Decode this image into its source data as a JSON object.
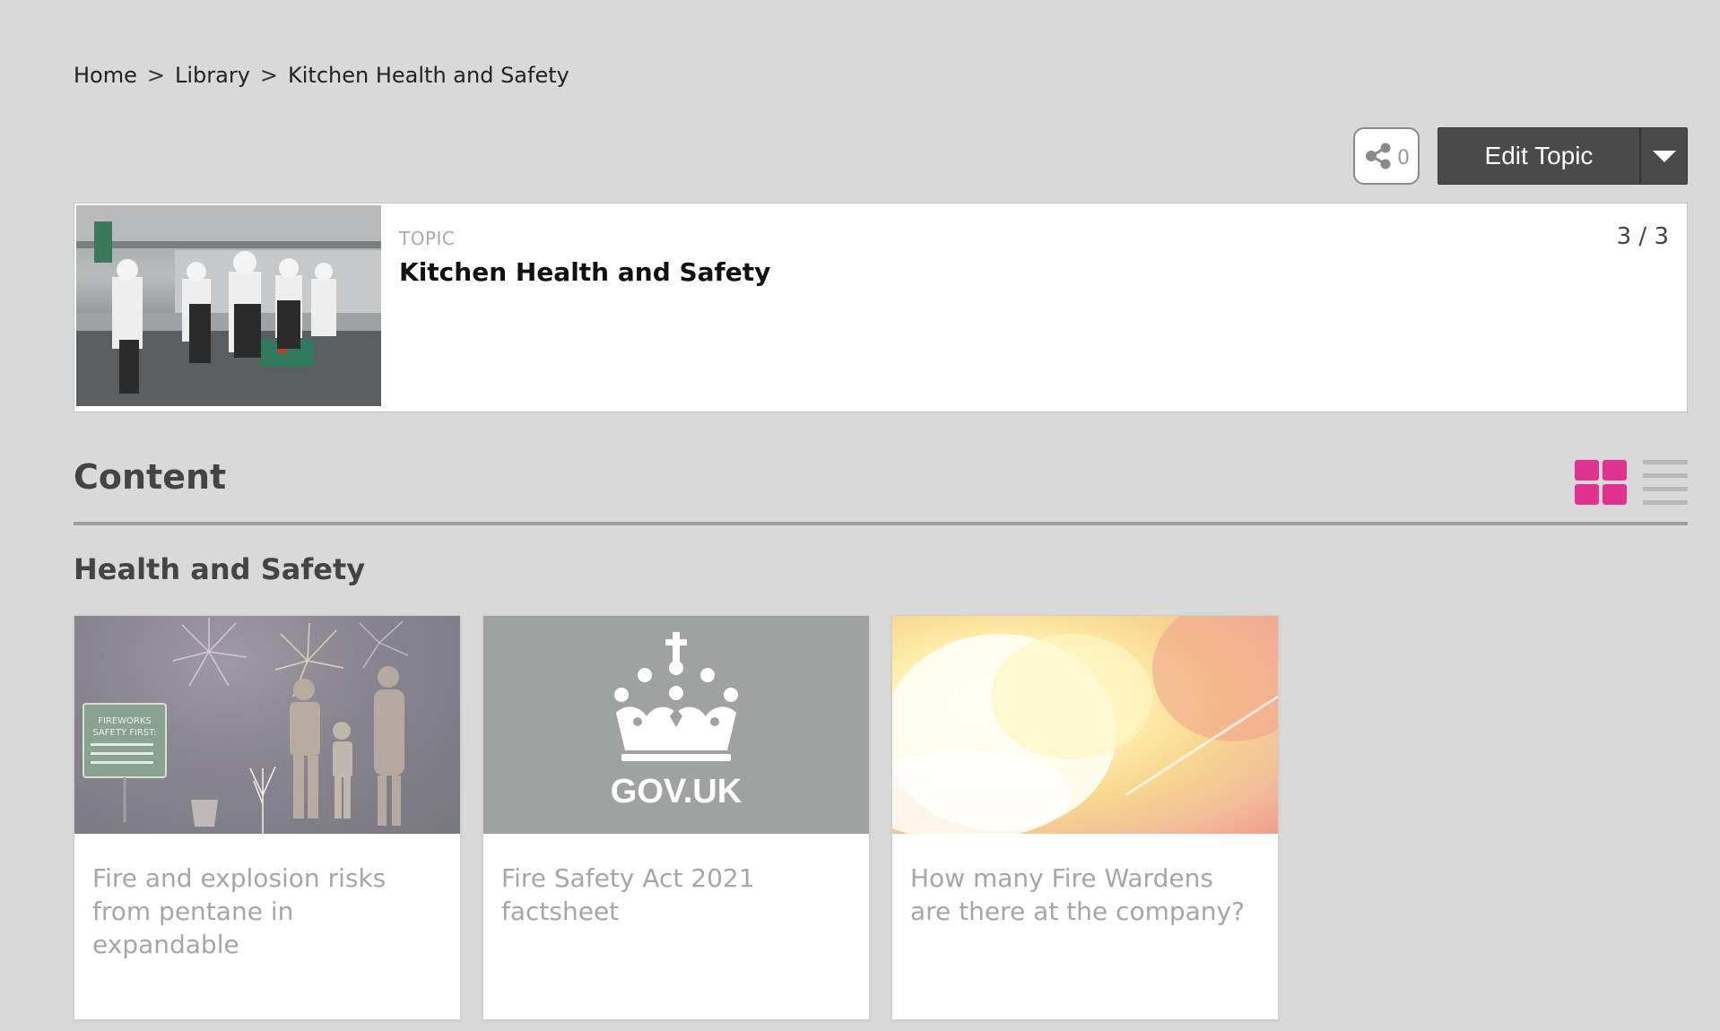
{
  "breadcrumb": {
    "items": [
      "Home",
      "Library"
    ],
    "current": "Kitchen Health and Safety",
    "separator": ">"
  },
  "actions": {
    "share_count": "0",
    "edit_label": "Edit Topic",
    "share_icon": "share-icon",
    "dropdown_icon": "caret-down-icon"
  },
  "topic": {
    "type_label": "TOPIC",
    "title": "Kitchen Health and Safety",
    "counter": "3 / 3"
  },
  "content": {
    "heading": "Content",
    "view_modes": [
      "grid-view-icon",
      "list-view-icon"
    ],
    "active_view": "grid",
    "accent_color": "#e0338f"
  },
  "section": {
    "title": "Health and Safety",
    "cards": [
      {
        "title": "Fire and explosion risks from pentane in expandable",
        "image": "fireworks-family-photo",
        "sign_text": "FIREWORKS SAFETY FIRST:"
      },
      {
        "title": "Fire Safety Act 2021 factsheet",
        "image": "gov-uk-crown-logo",
        "logo_text": "GOV.UK"
      },
      {
        "title": "How many Fire Wardens are there at the company?",
        "image": "fire-flame-photo"
      }
    ]
  }
}
